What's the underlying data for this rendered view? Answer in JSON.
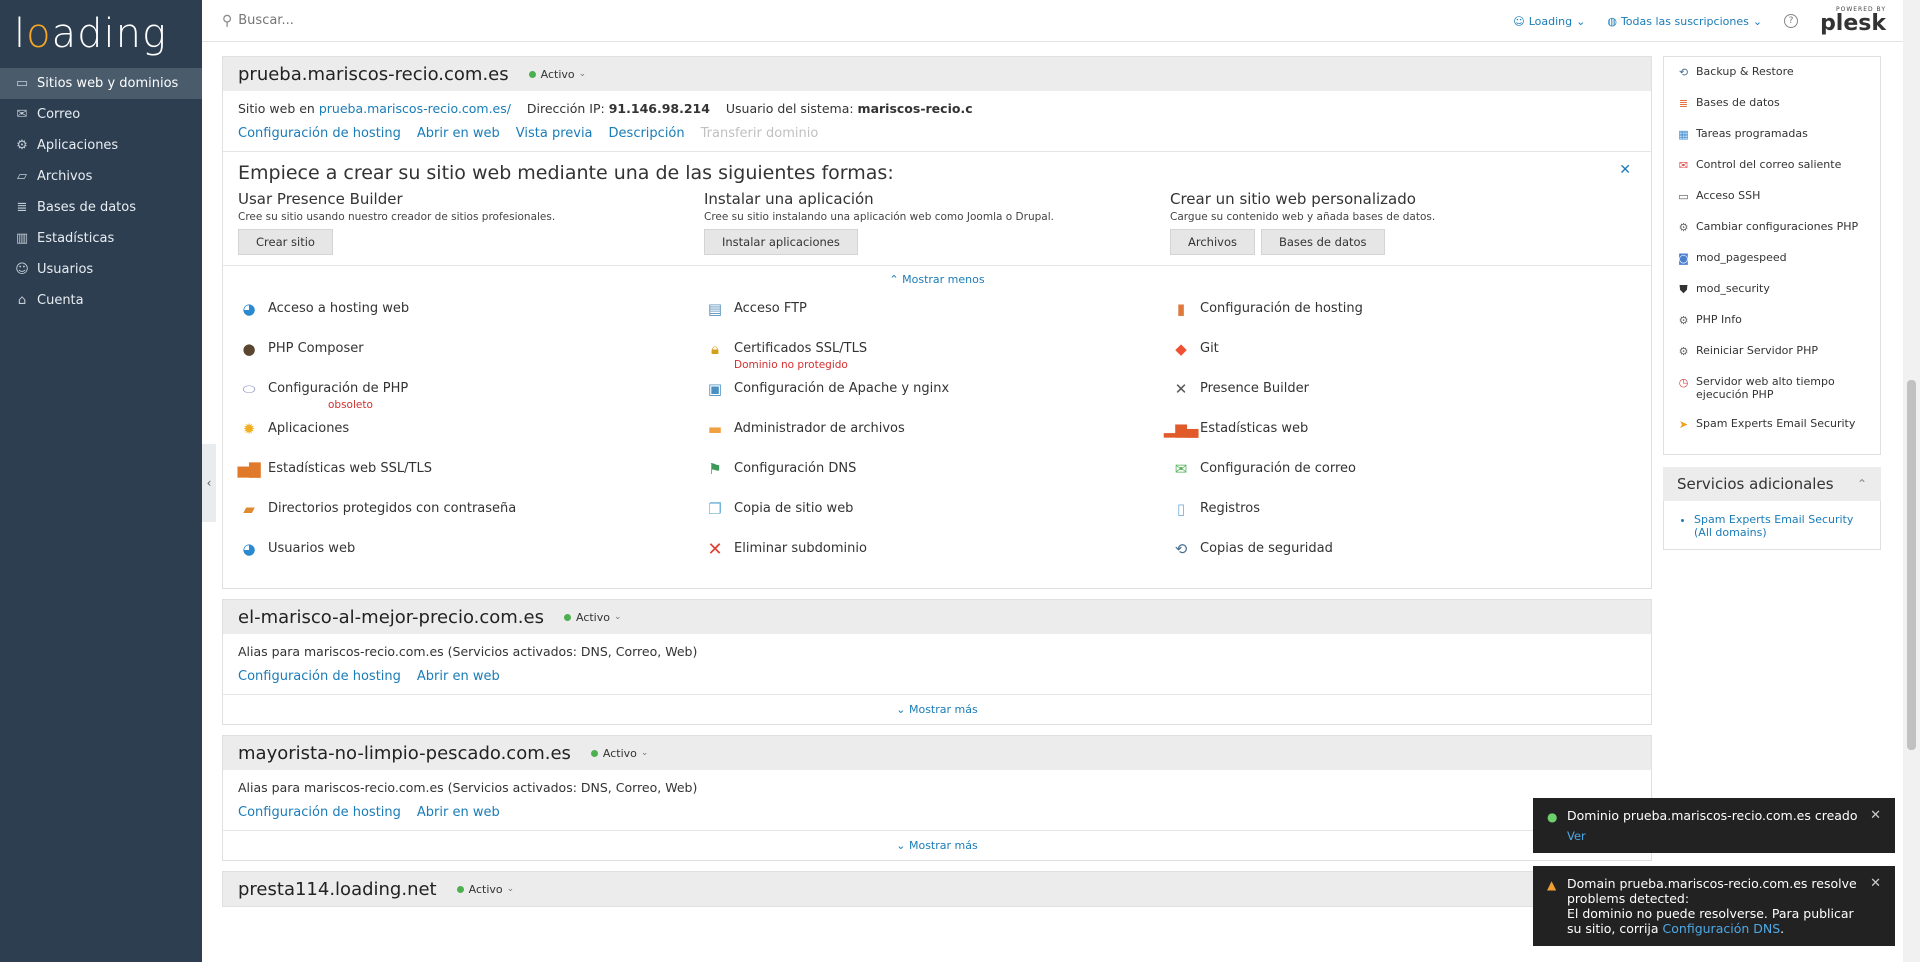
{
  "brand": {
    "logo_pre": "l",
    "logo_o": "o",
    "logo_post": "ading"
  },
  "sidebar": {
    "items": [
      {
        "label": "Sitios web y dominios",
        "icon": "monitor-icon"
      },
      {
        "label": "Correo",
        "icon": "mail-icon"
      },
      {
        "label": "Aplicaciones",
        "icon": "gear-icon"
      },
      {
        "label": "Archivos",
        "icon": "folder-icon"
      },
      {
        "label": "Bases de datos",
        "icon": "database-icon"
      },
      {
        "label": "Estadísticas",
        "icon": "chart-icon"
      },
      {
        "label": "Usuarios",
        "icon": "user-icon"
      },
      {
        "label": "Cuenta",
        "icon": "account-icon"
      }
    ]
  },
  "header": {
    "search_placeholder": "Buscar...",
    "user": "Loading",
    "subscriptions": "Todas las suscripciones",
    "powered_by": "POWERED BY",
    "plesk": "plesk"
  },
  "domain1": {
    "name": "prueba.mariscos-recio.com.es",
    "status": "Activo",
    "info_site_label": "Sitio web en",
    "info_site_link": "prueba.mariscos-recio.com.es/",
    "info_ip_label": "Dirección IP:",
    "info_ip": "91.146.98.214",
    "info_user_label": "Usuario del sistema:",
    "info_user": "mariscos-recio.c",
    "links": [
      "Configuración de hosting",
      "Abrir en web",
      "Vista previa",
      "Descripción",
      "Transferir dominio"
    ],
    "start": {
      "title": "Empiece a crear su sitio web mediante una de las siguientes formas:",
      "col1_title": "Usar Presence Builder",
      "col1_desc": "Cree su sitio usando nuestro creador de sitios profesionales.",
      "col1_btn": "Crear sitio",
      "col2_title": "Instalar una aplicación",
      "col2_desc": "Cree su sitio instalando una aplicación web como Joomla o Drupal.",
      "col2_btn": "Instalar aplicaciones",
      "col3_title": "Crear un sitio web personalizado",
      "col3_desc": "Cargue su contenido web y añada bases de datos.",
      "col3_btn1": "Archivos",
      "col3_btn2": "Bases de datos"
    },
    "show_less": "Mostrar menos",
    "tools": [
      {
        "label": "Acceso a hosting web",
        "sub": "",
        "icon": "globe-icon"
      },
      {
        "label": "Acceso FTP",
        "sub": "",
        "icon": "ftp-icon"
      },
      {
        "label": "Configuración de hosting",
        "sub": "",
        "icon": "hosting-icon"
      },
      {
        "label": "PHP Composer",
        "sub": "",
        "icon": "composer-icon"
      },
      {
        "label": "Certificados SSL/TLS",
        "sub": "Dominio no protegido",
        "icon": "lock-icon"
      },
      {
        "label": "Git",
        "sub": "",
        "icon": "git-icon"
      },
      {
        "label": "Configuración de PHP",
        "sub": "obsoleto",
        "icon": "php-icon"
      },
      {
        "label": "Configuración de Apache y nginx",
        "sub": "",
        "icon": "apache-icon"
      },
      {
        "label": "Presence Builder",
        "sub": "",
        "icon": "builder-icon"
      },
      {
        "label": "Aplicaciones",
        "sub": "",
        "icon": "apps-icon"
      },
      {
        "label": "Administrador de archivos",
        "sub": "",
        "icon": "folder-icon"
      },
      {
        "label": "Estadísticas web",
        "sub": "",
        "icon": "stats-icon"
      },
      {
        "label": "Estadísticas web SSL/TLS",
        "sub": "",
        "icon": "ssl-stats-icon"
      },
      {
        "label": "Configuración DNS",
        "sub": "",
        "icon": "dns-icon"
      },
      {
        "label": "Configuración de correo",
        "sub": "",
        "icon": "mail-settings-icon"
      },
      {
        "label": "Directorios protegidos con contraseña",
        "sub": "",
        "icon": "protected-folder-icon"
      },
      {
        "label": "Copia de sitio web",
        "sub": "",
        "icon": "copy-icon"
      },
      {
        "label": "Registros",
        "sub": "",
        "icon": "logs-icon"
      },
      {
        "label": "Usuarios web",
        "sub": "",
        "icon": "web-users-icon"
      },
      {
        "label": "Eliminar subdominio",
        "sub": "",
        "icon": "delete-icon"
      },
      {
        "label": "Copias de seguridad",
        "sub": "",
        "icon": "backup-icon"
      }
    ]
  },
  "domain2": {
    "name": "el-marisco-al-mejor-precio.com.es",
    "status": "Activo",
    "info": "Alias para mariscos-recio.com.es (Servicios activados: DNS, Correo, Web)",
    "links": [
      "Configuración de hosting",
      "Abrir en web"
    ],
    "show_more": "Mostrar más"
  },
  "domain3": {
    "name": "mayorista-no-limpio-pescado.com.es",
    "status": "Activo",
    "info": "Alias para mariscos-recio.com.es (Servicios activados: DNS, Correo, Web)",
    "links": [
      "Configuración de hosting",
      "Abrir en web"
    ],
    "show_more": "Mostrar más"
  },
  "domain4": {
    "name": "presta114.loading.net",
    "status": "Activo"
  },
  "right_panel": {
    "items": [
      {
        "label": "Backup & Restore",
        "icon": "backup-icon"
      },
      {
        "label": "Bases de datos",
        "icon": "database-icon"
      },
      {
        "label": "Tareas programadas",
        "icon": "calendar-icon"
      },
      {
        "label": "Control del correo saliente",
        "icon": "mail-out-icon"
      },
      {
        "label": "Acceso SSH",
        "icon": "terminal-icon"
      },
      {
        "label": "Cambiar configuraciones PHP",
        "icon": "php-settings-icon"
      },
      {
        "label": "mod_pagespeed",
        "icon": "pagespeed-icon"
      },
      {
        "label": "mod_security",
        "icon": "shield-icon"
      },
      {
        "label": "PHP Info",
        "icon": "php-info-icon"
      },
      {
        "label": "Reiniciar Servidor PHP",
        "icon": "restart-icon"
      },
      {
        "label": "Servidor web alto tiempo ejecución PHP",
        "icon": "timer-icon"
      },
      {
        "label": "Spam Experts Email Security",
        "icon": "spam-icon"
      }
    ],
    "addons_title": "Servicios adicionales",
    "addons_link": "Spam Experts Email Security (All domains)"
  },
  "toasts": {
    "t1_text": "Dominio prueba.mariscos-recio.com.es creado",
    "t1_link": "Ver",
    "t2_line1": "Domain prueba.mariscos-recio.com.es resolve problems detected:",
    "t2_line2": "El dominio no puede resolverse. Para publicar su sitio, corrija",
    "t2_link": "Configuración DNS",
    "t2_end": "."
  }
}
